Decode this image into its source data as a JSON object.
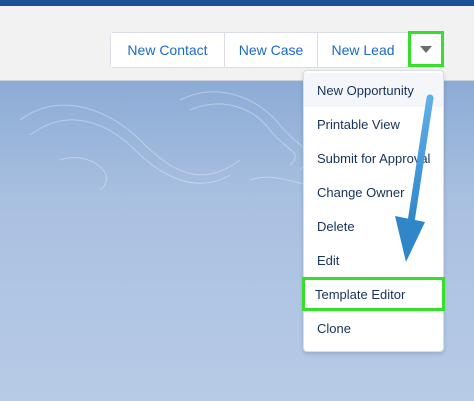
{
  "header": {
    "buttons": [
      {
        "label": "New Contact"
      },
      {
        "label": "New Case"
      },
      {
        "label": "New Lead"
      }
    ],
    "more_actions_icon": "chevron-down-icon"
  },
  "menu": {
    "items": [
      {
        "label": "New Opportunity"
      },
      {
        "label": "Printable View"
      },
      {
        "label": "Submit for Approval"
      },
      {
        "label": "Change Owner"
      },
      {
        "label": "Delete"
      },
      {
        "label": "Edit"
      },
      {
        "label": "Template Editor"
      },
      {
        "label": "Clone"
      }
    ]
  },
  "colors": {
    "accent": "#1b6ac9",
    "highlight": "#34e02a",
    "annotation_arrow": "#3a9ad9"
  }
}
